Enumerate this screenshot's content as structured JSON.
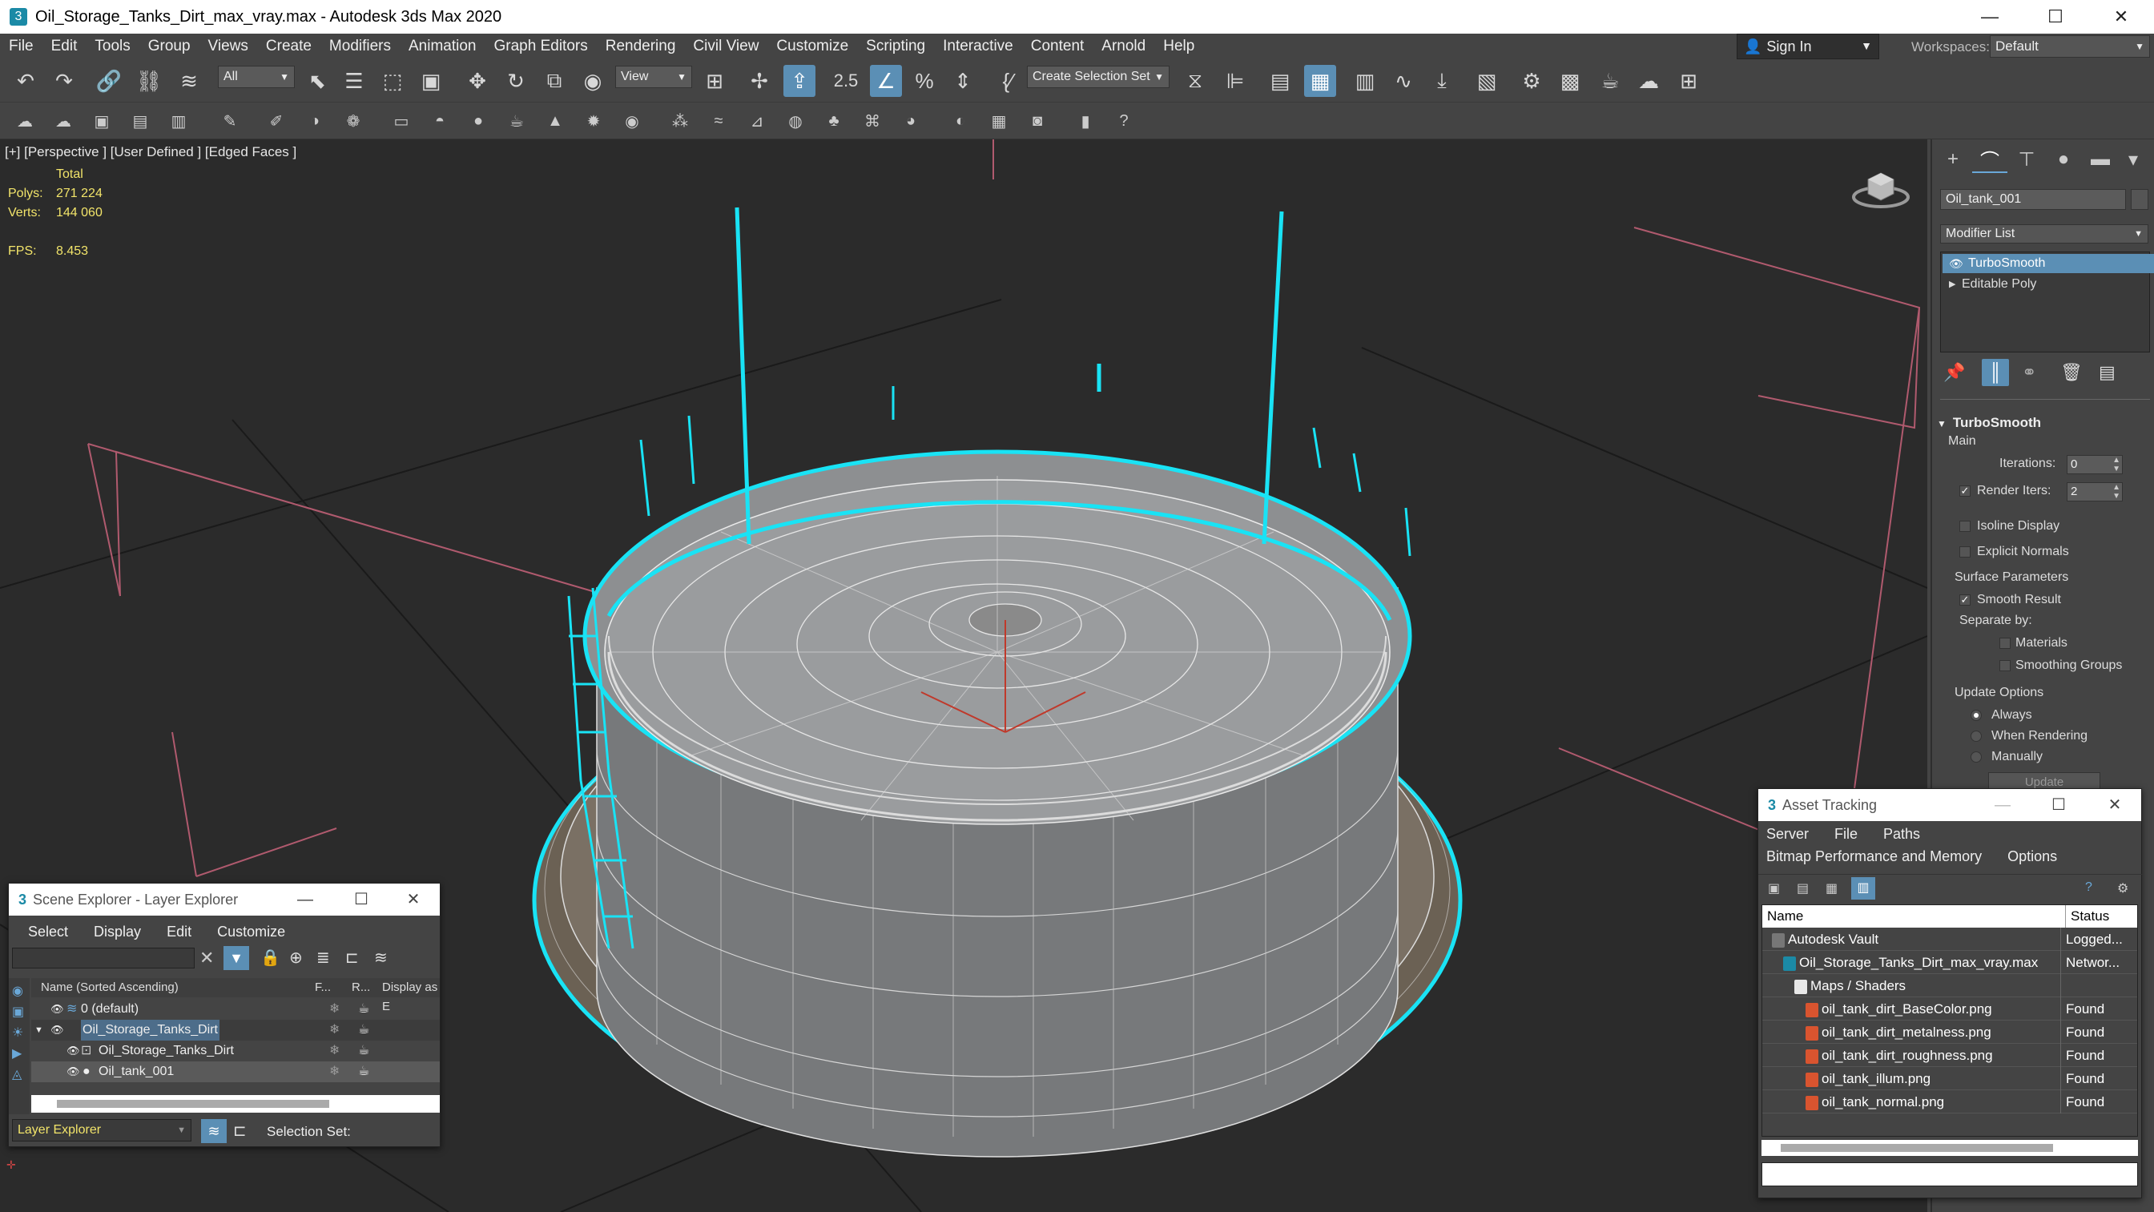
{
  "window": {
    "title": "Oil_Storage_Tanks_Dirt_max_vray.max - Autodesk 3ds Max 2020",
    "minimize_glyph": "—",
    "maximize_glyph": "☐",
    "close_glyph": "✕"
  },
  "menu": {
    "items": [
      "File",
      "Edit",
      "Tools",
      "Group",
      "Views",
      "Create",
      "Modifiers",
      "Animation",
      "Graph Editors",
      "Rendering",
      "Civil View",
      "Customize",
      "Scripting",
      "Interactive",
      "Content",
      "Arnold",
      "Help"
    ],
    "sign_in": "Sign In",
    "workspaces_label": "Workspaces:",
    "workspace_value": "Default"
  },
  "toolbar": {
    "selection_filter": "All",
    "reference_coord": "View",
    "named_selection": "Create Selection Set",
    "snap_label": "2.5"
  },
  "viewport": {
    "label": "[+] [Perspective ] [User Defined ] [Edged Faces ]",
    "stats_header": "Total",
    "polys_label": "Polys:",
    "polys_value": "271 224",
    "verts_label": "Verts:",
    "verts_value": "144 060",
    "fps_label": "FPS:",
    "fps_value": "8.453"
  },
  "command_panel": {
    "object_name": "Oil_tank_001",
    "modifier_list": "Modifier List",
    "stack": [
      "TurboSmooth",
      "Editable Poly"
    ],
    "rollout_title": "TurboSmooth",
    "main_label": "Main",
    "iterations_label": "Iterations:",
    "iterations_value": "0",
    "render_iters_label": "Render Iters:",
    "render_iters_value": "2",
    "render_iters_checked": true,
    "isoline_label": "Isoline Display",
    "explicit_normals_label": "Explicit Normals",
    "surface_params_label": "Surface Parameters",
    "smooth_result_label": "Smooth Result",
    "separate_by_label": "Separate by:",
    "materials_label": "Materials",
    "smoothing_groups_label": "Smoothing Groups",
    "update_options_label": "Update Options",
    "always_label": "Always",
    "when_rendering_label": "When Rendering",
    "manually_label": "Manually",
    "update_button": "Update"
  },
  "scene_explorer": {
    "title": "Scene Explorer - Layer Explorer",
    "menu": [
      "Select",
      "Display",
      "Edit",
      "Customize"
    ],
    "col_name": "Name (Sorted Ascending)",
    "col_f": "F...",
    "col_r": "R...",
    "col_display": "Display as E",
    "rows": [
      {
        "name": "0 (default)",
        "indent": 0
      },
      {
        "name": "Oil_Storage_Tanks_Dirt",
        "indent": 0
      },
      {
        "name": "Oil_Storage_Tanks_Dirt",
        "indent": 1
      },
      {
        "name": "Oil_tank_001",
        "indent": 1
      }
    ],
    "footer_combo": "Layer Explorer",
    "selection_set_label": "Selection Set:"
  },
  "asset_tracking": {
    "title": "Asset Tracking",
    "menu_row1": [
      "Server",
      "File",
      "Paths"
    ],
    "menu_row2": [
      "Bitmap Performance and Memory",
      "Options"
    ],
    "col_name": "Name",
    "col_status": "Status",
    "rows": [
      {
        "name": "Autodesk Vault",
        "status": "Logged...",
        "indent": 0,
        "icon": "vault-icon"
      },
      {
        "name": "Oil_Storage_Tanks_Dirt_max_vray.max",
        "status": "Networ...",
        "indent": 1,
        "icon": "max-file-icon"
      },
      {
        "name": "Maps / Shaders",
        "status": "",
        "indent": 2,
        "icon": "folder-icon"
      },
      {
        "name": "oil_tank_dirt_BaseColor.png",
        "status": "Found",
        "indent": 3,
        "icon": "image-file-icon"
      },
      {
        "name": "oil_tank_dirt_metalness.png",
        "status": "Found",
        "indent": 3,
        "icon": "image-file-icon"
      },
      {
        "name": "oil_tank_dirt_roughness.png",
        "status": "Found",
        "indent": 3,
        "icon": "image-file-icon"
      },
      {
        "name": "oil_tank_illum.png",
        "status": "Found",
        "indent": 3,
        "icon": "image-file-icon"
      },
      {
        "name": "oil_tank_normal.png",
        "status": "Found",
        "indent": 3,
        "icon": "image-file-icon"
      }
    ]
  },
  "colors": {
    "accent": "#5b8fb5",
    "selection_cyan": "#19e3f5",
    "stats_yellow": "#f2e46a",
    "viewport_bg": "#2b2b2b"
  }
}
